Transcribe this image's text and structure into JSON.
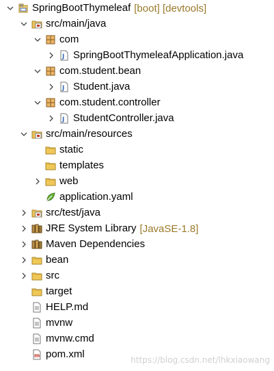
{
  "tree": [
    {
      "id": "proj",
      "label": "SpringBootThymeleaf",
      "deco": "[boot] [devtools]",
      "icon": "project-icon",
      "toggle": "expanded",
      "depth": 0
    },
    {
      "id": "src-main-java",
      "label": "src/main/java",
      "icon": "source-folder-icon",
      "toggle": "expanded",
      "depth": 1
    },
    {
      "id": "pkg-com",
      "label": "com",
      "icon": "package-icon",
      "toggle": "expanded",
      "depth": 2
    },
    {
      "id": "file-app",
      "label": "SpringBootThymeleafApplication.java",
      "icon": "java-file-icon",
      "toggle": "collapsed",
      "depth": 3
    },
    {
      "id": "pkg-bean",
      "label": "com.student.bean",
      "icon": "package-icon",
      "toggle": "expanded",
      "depth": 2
    },
    {
      "id": "file-student",
      "label": "Student.java",
      "icon": "java-file-icon",
      "toggle": "collapsed",
      "depth": 3
    },
    {
      "id": "pkg-controller",
      "label": "com.student.controller",
      "icon": "package-icon",
      "toggle": "expanded",
      "depth": 2
    },
    {
      "id": "file-controller",
      "label": "StudentController.java",
      "icon": "java-file-icon",
      "toggle": "collapsed",
      "depth": 3
    },
    {
      "id": "src-main-res",
      "label": "src/main/resources",
      "icon": "source-folder-icon",
      "toggle": "expanded",
      "depth": 1
    },
    {
      "id": "dir-static",
      "label": "static",
      "icon": "folder-icon",
      "toggle": "none",
      "depth": 2
    },
    {
      "id": "dir-templates",
      "label": "templates",
      "icon": "folder-icon",
      "toggle": "none",
      "depth": 2
    },
    {
      "id": "dir-web",
      "label": "web",
      "icon": "folder-icon",
      "toggle": "collapsed",
      "depth": 2
    },
    {
      "id": "file-yaml",
      "label": "application.yaml",
      "icon": "spring-yaml-icon",
      "toggle": "none",
      "depth": 2
    },
    {
      "id": "src-test-java",
      "label": "src/test/java",
      "icon": "source-folder-icon",
      "toggle": "collapsed",
      "depth": 1
    },
    {
      "id": "jre",
      "label": "JRE System Library",
      "deco": "[JavaSE-1.8]",
      "icon": "library-icon",
      "toggle": "collapsed",
      "depth": 1
    },
    {
      "id": "maven",
      "label": "Maven Dependencies",
      "icon": "library-icon",
      "toggle": "collapsed",
      "depth": 1
    },
    {
      "id": "dir-bean",
      "label": "bean",
      "icon": "folder-icon",
      "toggle": "collapsed",
      "depth": 1
    },
    {
      "id": "dir-src",
      "label": "src",
      "icon": "folder-icon",
      "toggle": "collapsed",
      "depth": 1
    },
    {
      "id": "dir-target",
      "label": "target",
      "icon": "folder-icon",
      "toggle": "none",
      "depth": 1
    },
    {
      "id": "file-help",
      "label": "HELP.md",
      "icon": "text-file-icon",
      "toggle": "none",
      "depth": 1
    },
    {
      "id": "file-mvnw",
      "label": "mvnw",
      "icon": "text-file-icon",
      "toggle": "none",
      "depth": 1
    },
    {
      "id": "file-mvnwcmd",
      "label": "mvnw.cmd",
      "icon": "text-file-icon",
      "toggle": "none",
      "depth": 1
    },
    {
      "id": "file-pom",
      "label": "pom.xml",
      "icon": "maven-pom-icon",
      "toggle": "none",
      "depth": 1
    }
  ],
  "watermark": "https://blog.csdn.net/lhkxiaowang",
  "colors": {
    "decoration": "#9a7a2a",
    "folder": "#e8c15d",
    "package": "#b07a30",
    "java": "#3b6cb5",
    "spring": "#6db33f"
  }
}
